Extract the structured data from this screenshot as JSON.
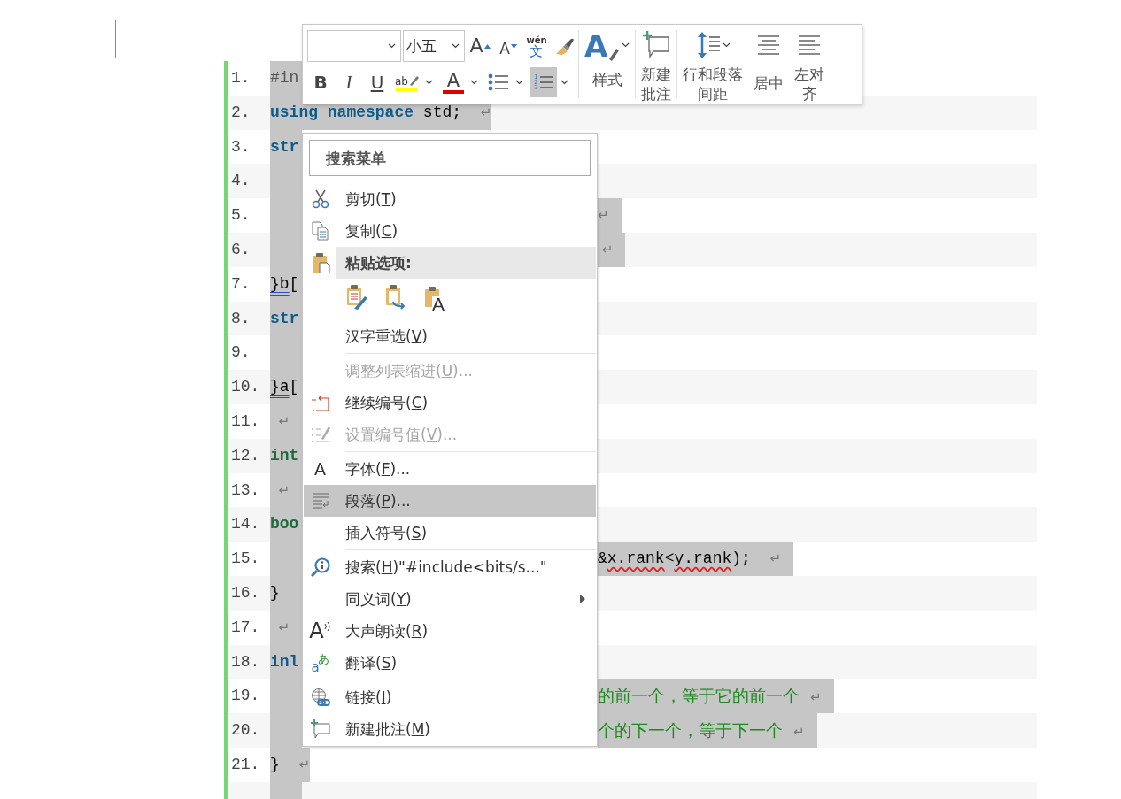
{
  "document": {
    "lines": [
      {
        "number": "1.",
        "selected": true,
        "left": [
          {
            "kind": "preprocessor",
            "text": "#in"
          }
        ]
      },
      {
        "number": "2.",
        "selected": true,
        "left": [
          {
            "kind": "keyword",
            "text": "using namespace"
          },
          {
            "kind": "plain",
            "text": " std;  "
          },
          {
            "kind": "mark",
            "text": "↵"
          }
        ]
      },
      {
        "number": "3.",
        "selected": true,
        "left": [
          {
            "kind": "keyword",
            "text": "str"
          }
        ]
      },
      {
        "number": "4.",
        "selected": true
      },
      {
        "number": "5.",
        "selected": true,
        "right": [
          {
            "kind": "mark",
            "text": "↵"
          }
        ]
      },
      {
        "number": "6.",
        "selected": true,
        "right": [
          {
            "kind": "mark",
            "text": " ↵"
          }
        ]
      },
      {
        "number": "7.",
        "selected": true,
        "left": [
          {
            "kind": "underlined",
            "text": "}b"
          },
          {
            "kind": "plain",
            "text": "["
          }
        ]
      },
      {
        "number": "8.",
        "selected": true,
        "left": [
          {
            "kind": "keyword",
            "text": "str"
          }
        ]
      },
      {
        "number": "9.",
        "selected": true
      },
      {
        "number": "10.",
        "selected": true,
        "left": [
          {
            "kind": "underlined",
            "text": "}a"
          },
          {
            "kind": "plain",
            "text": "["
          }
        ]
      },
      {
        "number": "11.",
        "selected": true,
        "left": [
          {
            "kind": "mark",
            "text": "  ↵"
          }
        ]
      },
      {
        "number": "12.",
        "selected": true,
        "left": [
          {
            "kind": "type",
            "text": "int"
          }
        ]
      },
      {
        "number": "13.",
        "selected": true,
        "left": [
          {
            "kind": "mark",
            "text": "  ↵"
          }
        ]
      },
      {
        "number": "14.",
        "selected": true,
        "left": [
          {
            "kind": "type",
            "text": "boo"
          }
        ]
      },
      {
        "number": "15.",
        "selected": true,
        "right": [
          {
            "kind": "plain",
            "text": "&"
          },
          {
            "kind": "typo",
            "text": "x.rank"
          },
          {
            "kind": "plain",
            "text": "<"
          },
          {
            "kind": "typo",
            "text": "y.rank"
          },
          {
            "kind": "plain",
            "text": ");  "
          },
          {
            "kind": "mark",
            "text": "↵"
          }
        ]
      },
      {
        "number": "16.",
        "selected": true,
        "left": [
          {
            "kind": "plain",
            "text": "}"
          }
        ]
      },
      {
        "number": "17.",
        "selected": true,
        "left": [
          {
            "kind": "mark",
            "text": "  ↵"
          }
        ]
      },
      {
        "number": "18.",
        "selected": true,
        "left": [
          {
            "kind": "keyword",
            "text": "inl"
          }
        ]
      },
      {
        "number": "19.",
        "selected": true,
        "right": [
          {
            "kind": "comment",
            "text": "的前一个，等于它的前一个  "
          },
          {
            "kind": "mark",
            "text": "↵"
          }
        ]
      },
      {
        "number": "20.",
        "selected": true,
        "right": [
          {
            "kind": "comment",
            "text": "个的下一个，等于下一个  "
          },
          {
            "kind": "mark",
            "text": "↵"
          }
        ]
      },
      {
        "number": "21.",
        "selected": true,
        "left": [
          {
            "kind": "plain",
            "text": "}  "
          },
          {
            "kind": "mark",
            "text": "↵"
          }
        ]
      },
      {
        "selected": true
      }
    ]
  },
  "mini_toolbar": {
    "font_size": "小五",
    "top_buttons": [
      {
        "kind": "grow_font",
        "glyph": "A"
      },
      {
        "kind": "shrink_font",
        "glyph": "A"
      },
      {
        "kind": "phonetic",
        "glyph": "wén",
        "glyph2": "文"
      },
      {
        "kind": "format_painter"
      }
    ],
    "bottom_buttons": [
      {
        "kind": "bold",
        "glyph": "B",
        "on": false
      },
      {
        "kind": "italic",
        "glyph": "I",
        "on": false
      },
      {
        "kind": "underline",
        "glyph": "U",
        "on": false
      },
      {
        "kind": "highlight",
        "glyph": "ab",
        "on": false,
        "caret": true
      },
      {
        "kind": "font_color",
        "glyph": "A",
        "on": false,
        "caret": true
      },
      {
        "kind": "bullets",
        "on": false,
        "caret": true
      },
      {
        "kind": "numbering",
        "glyph": "123",
        "on": true,
        "caret": true
      }
    ],
    "large_buttons": [
      {
        "kind": "styles",
        "glyph": "A",
        "label": "样式",
        "caret": true,
        "separator_before": true
      },
      {
        "kind": "new_comment",
        "label": "新建批注",
        "separator_before": true
      },
      {
        "kind": "line_spacing",
        "label": "行和段落间距",
        "caret": true,
        "separator_before": true
      },
      {
        "kind": "center",
        "label": "居中",
        "separator_before": false
      },
      {
        "kind": "align_left",
        "label": "左对齐",
        "separator_before": false
      }
    ]
  },
  "context_menu": {
    "search_placeholder": "搜索菜单",
    "items": [
      {
        "kind": "cut",
        "parts": [
          "剪切(",
          "T",
          ")"
        ],
        "disabled": false,
        "selected": false
      },
      {
        "kind": "copy",
        "parts": [
          "复制(",
          "C",
          ")"
        ],
        "disabled": false,
        "selected": false
      },
      {
        "kind": "paste_header",
        "parts": [
          "粘贴选项:"
        ],
        "selected": false
      },
      {
        "kind": "paste_options",
        "options": [
          {
            "kind": "keep_source"
          },
          {
            "kind": "merge"
          },
          {
            "kind": "text_only",
            "glyph": "A"
          }
        ]
      },
      {
        "kind": "reselect",
        "parts": [
          "汉字重选(",
          "V",
          ")"
        ],
        "disabled": false,
        "selected": false,
        "separator_before": true
      },
      {
        "kind": "adjust_indent",
        "parts": [
          "调整列表缩进(",
          "U",
          ")..."
        ],
        "disabled": true,
        "selected": false,
        "separator_before": true
      },
      {
        "kind": "continue_numbering",
        "parts": [
          "继续编号(",
          "C",
          ")"
        ],
        "disabled": false,
        "selected": false
      },
      {
        "kind": "set_number_value",
        "parts": [
          "设置编号值(",
          "V",
          ")..."
        ],
        "disabled": true,
        "selected": false
      },
      {
        "kind": "font",
        "glyph": "A",
        "parts": [
          "字体(",
          "F",
          ")..."
        ],
        "disabled": false,
        "selected": false,
        "separator_before": true
      },
      {
        "kind": "paragraph",
        "parts": [
          "段落(",
          "P",
          ")..."
        ],
        "disabled": false,
        "selected": true
      },
      {
        "kind": "insert_symbol",
        "parts": [
          "插入符号(",
          "S",
          ")"
        ],
        "disabled": false,
        "selected": false
      },
      {
        "kind": "search",
        "parts": [
          "搜索(",
          "H",
          ")\"#include<bits/s...\""
        ],
        "disabled": false,
        "selected": false,
        "separator_before": true
      },
      {
        "kind": "synonyms",
        "parts": [
          "同义词(",
          "Y",
          ")"
        ],
        "disabled": false,
        "selected": false,
        "submenu": true
      },
      {
        "kind": "read_aloud",
        "glyph": "A",
        "parts": [
          "大声朗读(",
          "R",
          ")"
        ],
        "disabled": false,
        "selected": false
      },
      {
        "kind": "translate",
        "glyph": "あ",
        "glyph2": "a",
        "parts": [
          "翻译(",
          "S",
          ")"
        ],
        "disabled": false,
        "selected": false
      },
      {
        "kind": "link",
        "parts": [
          "链接(",
          "I",
          ")"
        ],
        "disabled": false,
        "selected": false,
        "separator_before": true
      },
      {
        "kind": "new_comment",
        "parts": [
          "新建批注(",
          "M",
          ")"
        ],
        "disabled": false,
        "selected": false
      }
    ]
  }
}
